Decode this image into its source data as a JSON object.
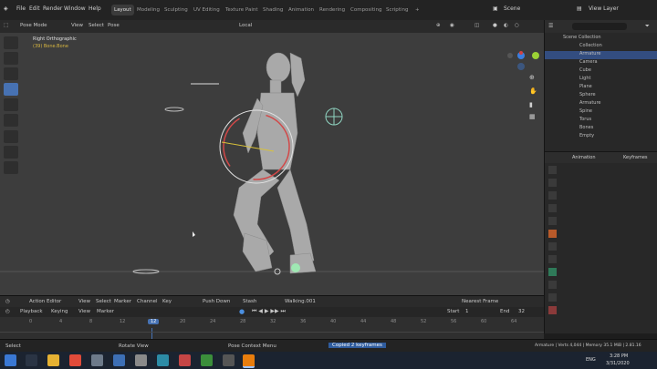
{
  "menu": [
    "File",
    "Edit",
    "Render",
    "Window",
    "Help"
  ],
  "workspaces": [
    "Layout",
    "Modeling",
    "Sculpting",
    "UV Editing",
    "Texture Paint",
    "Shading",
    "Animation",
    "Rendering",
    "Compositing",
    "Scripting"
  ],
  "active_workspace": "Layout",
  "scene": "Scene",
  "view_layer": "View Layer",
  "viewport_header": {
    "mode": "Pose Mode",
    "menus": [
      "View",
      "Select",
      "Pose"
    ],
    "transform": "Local"
  },
  "viewport_overlay": {
    "view_name": "Right Orthographic",
    "collection": "(39) Bone.Bone"
  },
  "outliner": {
    "title": "Scene Collection",
    "rows": [
      "Collection",
      "Armature",
      "Camera",
      "Cube",
      "Light",
      "Plane",
      "Sphere",
      "Armature",
      "Spine",
      "Torus",
      "Bones",
      "Empty"
    ]
  },
  "properties_tabs": [
    "Animation",
    "Keyframes"
  ],
  "timeline_header": {
    "editor": "Action Editor",
    "menus": [
      "View",
      "Select",
      "Marker",
      "Channel",
      "Key"
    ],
    "push_down": "Push Down",
    "stash": "Stash",
    "action": "Walking.001",
    "filter": "Nearest Frame"
  },
  "timeline_header2": {
    "menus": [
      "Playback",
      "Keying",
      "View",
      "Marker"
    ],
    "start_label": "Start",
    "start": "1",
    "end_label": "End",
    "end": "32"
  },
  "timeline_ticks": [
    "0",
    "4",
    "8",
    "12",
    "16",
    "20",
    "24",
    "28",
    "32",
    "36",
    "40",
    "44",
    "48",
    "52",
    "56",
    "60",
    "64"
  ],
  "current_frame": "12",
  "status": {
    "left": "Select",
    "mid1": "Rotate View",
    "mid2": "Pose Context Menu",
    "toast": "Copied 2 keyframes",
    "right": "Armature | Verts 4,044 | Memory 35.1 MiB | 2.81.16"
  },
  "taskbar": {
    "time": "3:28 PM",
    "date": "3/31/2020",
    "lang": "ENG"
  }
}
